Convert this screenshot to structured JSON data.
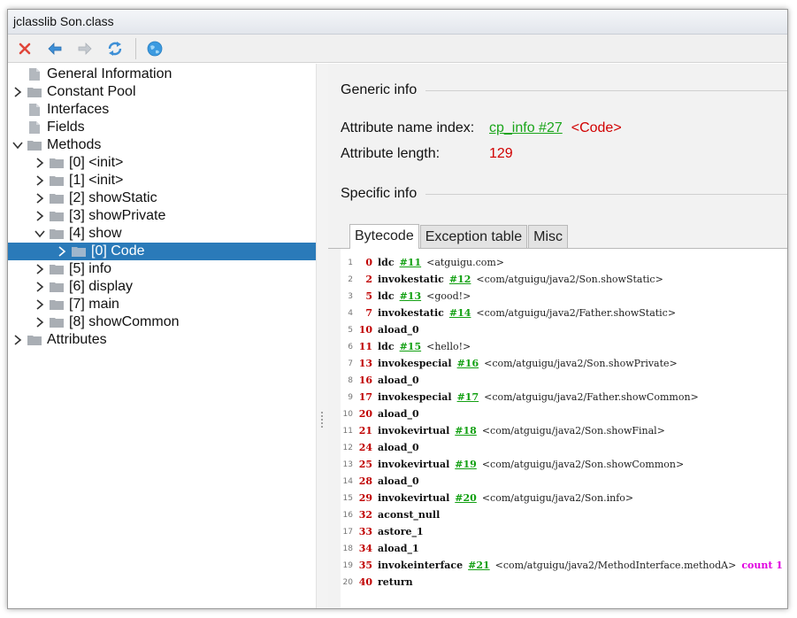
{
  "window": {
    "title": "jclasslib Son.class"
  },
  "toolbar": {
    "close": "close-icon",
    "back": "back-arrow-icon",
    "forward": "forward-arrow-icon",
    "reload": "reload-icon",
    "web": "globe-icon"
  },
  "tree": {
    "general": "General Information",
    "constant_pool": "Constant Pool",
    "interfaces": "Interfaces",
    "fields": "Fields",
    "methods": "Methods",
    "method_items": [
      "[0] <init>",
      "[1] <init>",
      "[2] showStatic",
      "[3] showPrivate",
      "[4] show",
      "[5] info",
      "[6] display",
      "[7] main",
      "[8] showCommon"
    ],
    "show_child": "[0] Code",
    "attributes": "Attributes"
  },
  "detail": {
    "generic_title": "Generic info",
    "name_index_label": "Attribute name index:",
    "name_index_link": "cp_info #27",
    "name_index_value": "<Code>",
    "length_label": "Attribute length:",
    "length_value": "129",
    "specific_title": "Specific info",
    "tabs": [
      "Bytecode",
      "Exception table",
      "Misc"
    ]
  },
  "bytecode": [
    {
      "ln": "1",
      "off": "0",
      "op": "ldc",
      "ref": "#11",
      "comment": "<atguigu.com>"
    },
    {
      "ln": "2",
      "off": "2",
      "op": "invokestatic",
      "ref": "#12",
      "comment": "<com/atguigu/java2/Son.showStatic>"
    },
    {
      "ln": "3",
      "off": "5",
      "op": "ldc",
      "ref": "#13",
      "comment": "<good!>"
    },
    {
      "ln": "4",
      "off": "7",
      "op": "invokestatic",
      "ref": "#14",
      "comment": "<com/atguigu/java2/Father.showStatic>"
    },
    {
      "ln": "5",
      "off": "10",
      "op": "aload_0",
      "ref": "",
      "comment": ""
    },
    {
      "ln": "6",
      "off": "11",
      "op": "ldc",
      "ref": "#15",
      "comment": "<hello!>"
    },
    {
      "ln": "7",
      "off": "13",
      "op": "invokespecial",
      "ref": "#16",
      "comment": "<com/atguigu/java2/Son.showPrivate>"
    },
    {
      "ln": "8",
      "off": "16",
      "op": "aload_0",
      "ref": "",
      "comment": ""
    },
    {
      "ln": "9",
      "off": "17",
      "op": "invokespecial",
      "ref": "#17",
      "comment": "<com/atguigu/java2/Father.showCommon>"
    },
    {
      "ln": "10",
      "off": "20",
      "op": "aload_0",
      "ref": "",
      "comment": ""
    },
    {
      "ln": "11",
      "off": "21",
      "op": "invokevirtual",
      "ref": "#18",
      "comment": "<com/atguigu/java2/Son.showFinal>"
    },
    {
      "ln": "12",
      "off": "24",
      "op": "aload_0",
      "ref": "",
      "comment": ""
    },
    {
      "ln": "13",
      "off": "25",
      "op": "invokevirtual",
      "ref": "#19",
      "comment": "<com/atguigu/java2/Son.showCommon>"
    },
    {
      "ln": "14",
      "off": "28",
      "op": "aload_0",
      "ref": "",
      "comment": ""
    },
    {
      "ln": "15",
      "off": "29",
      "op": "invokevirtual",
      "ref": "#20",
      "comment": "<com/atguigu/java2/Son.info>"
    },
    {
      "ln": "16",
      "off": "32",
      "op": "aconst_null",
      "ref": "",
      "comment": ""
    },
    {
      "ln": "17",
      "off": "33",
      "op": "astore_1",
      "ref": "",
      "comment": ""
    },
    {
      "ln": "18",
      "off": "34",
      "op": "aload_1",
      "ref": "",
      "comment": ""
    },
    {
      "ln": "19",
      "off": "35",
      "op": "invokeinterface",
      "ref": "#21",
      "comment": "<com/atguigu/java2/MethodInterface.methodA>",
      "extra": "count 1"
    },
    {
      "ln": "20",
      "off": "40",
      "op": "return",
      "ref": "",
      "comment": ""
    }
  ],
  "colors": {
    "selection": "#2a7ab9",
    "link": "#1aa51a",
    "value": "#d10000",
    "keyword": "#e000e0"
  }
}
